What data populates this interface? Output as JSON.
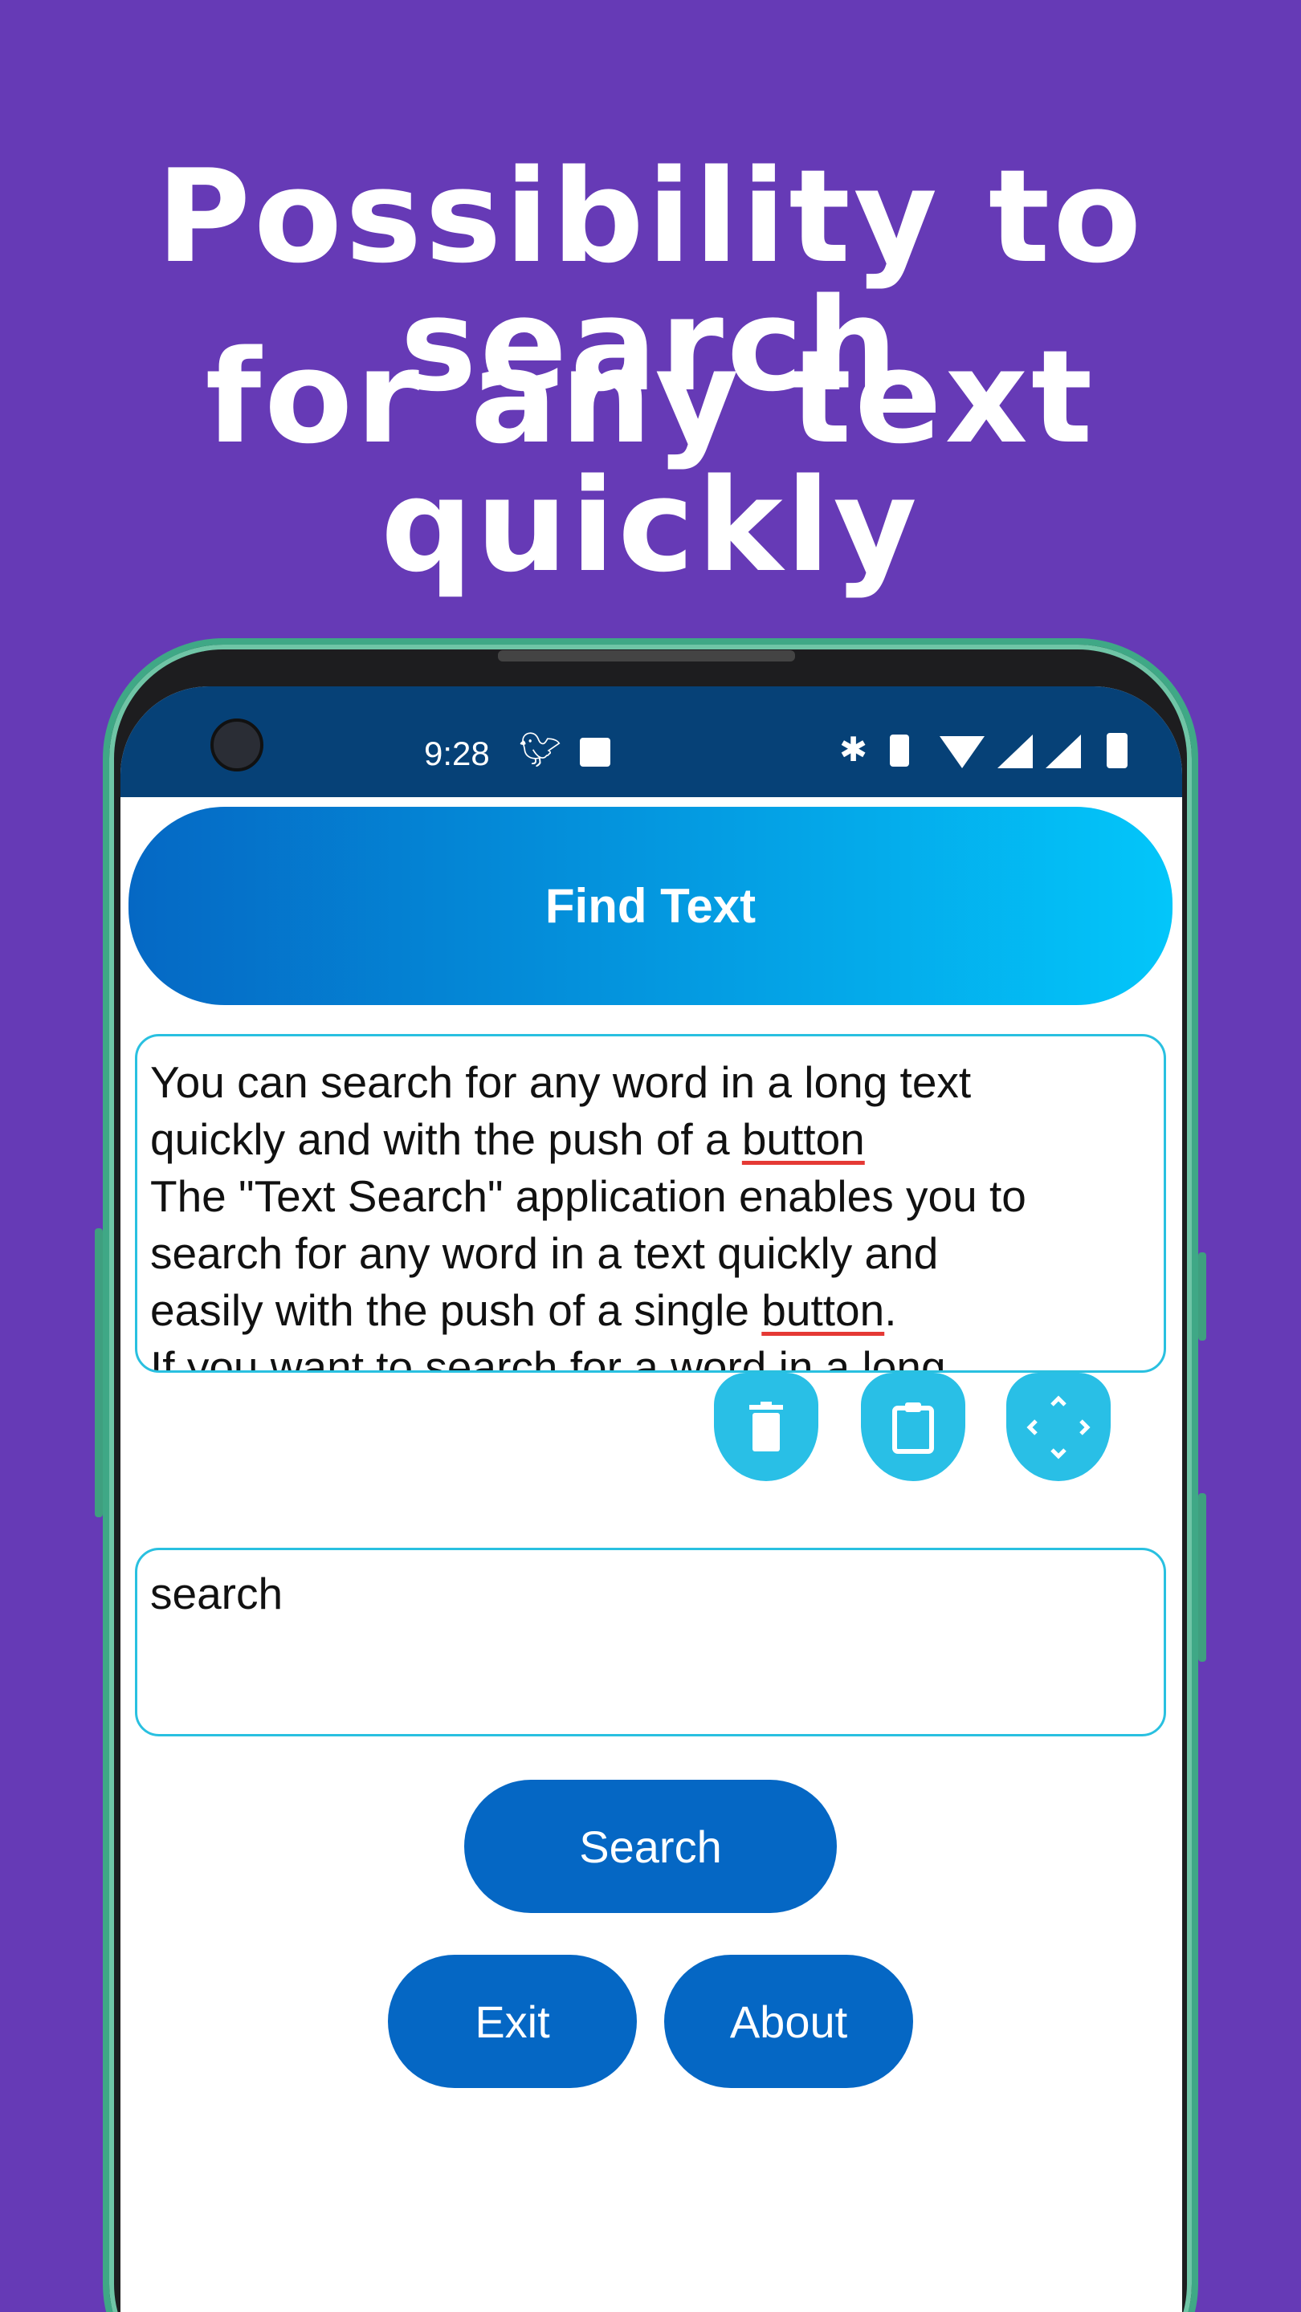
{
  "promo": {
    "line1": "Possibility to search",
    "line2": "for any text quickly"
  },
  "status_bar": {
    "time": "9:28",
    "left_icons": [
      "twitter-icon",
      "image-icon"
    ],
    "right_icons": [
      "bluetooth-icon",
      "vibrate-icon",
      "wifi-icon",
      "signal-icon",
      "signal-no-data-icon",
      "battery-icon"
    ]
  },
  "app": {
    "title": "Find Text",
    "text_area": {
      "lines": [
        "You can search for any word in a long text",
        "quickly and with the push of a ",
        "The \"Text Search\" application enables you to",
        "search for any word in a text quickly and",
        "easily with the push of a single ",
        ".",
        "If you want to search for a word in a long"
      ],
      "misspelled": "button"
    },
    "tools": [
      {
        "icon": "trash-icon"
      },
      {
        "icon": "clipboard-icon"
      },
      {
        "icon": "expand-icon"
      }
    ],
    "search_input": {
      "value": "search"
    },
    "search_button": "Search",
    "exit_button": "Exit",
    "about_button": "About"
  },
  "colors": {
    "background": "#663ab6",
    "status_bar": "#064177",
    "button": "#0567c4",
    "accent": "#29bfe6"
  }
}
